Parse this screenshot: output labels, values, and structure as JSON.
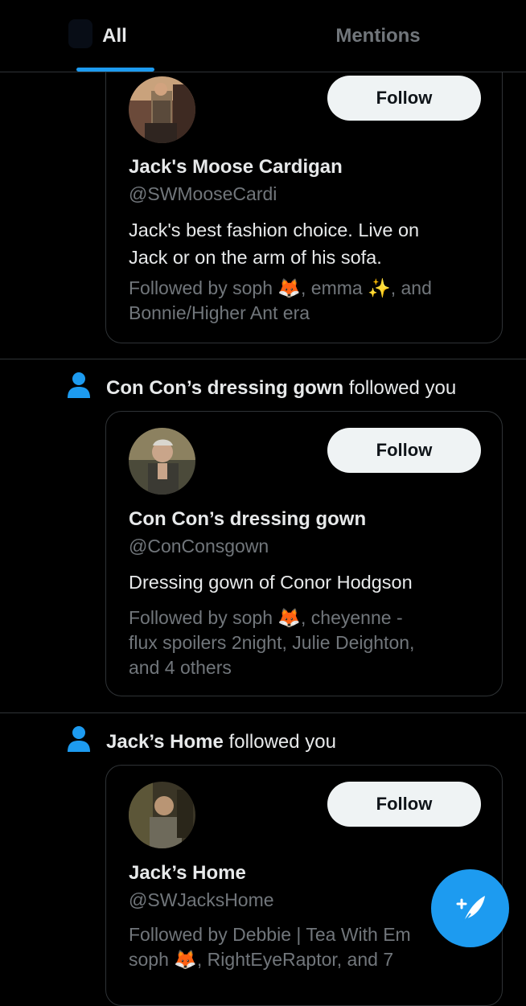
{
  "tabs": [
    {
      "label": "All",
      "active": true
    },
    {
      "label": "Mentions",
      "active": false
    }
  ],
  "notifications": [
    {
      "actor": "",
      "action": "",
      "card": {
        "name": "Jack's Moose Cardigan",
        "handle": "@SWMooseCardi",
        "follow_label": "Follow",
        "bio_lines": [
          "Jack's best fashion choice. Live on",
          "Jack or on the arm of his sofa."
        ],
        "followed_by_lines": [
          "Followed by soph 🦊, emma ✨, and",
          "Bonnie/Higher Ant era"
        ]
      }
    },
    {
      "actor": "Con Con’s dressing gown",
      "action": "followed you",
      "card": {
        "name": "Con Con’s dressing gown",
        "handle": "@ConConsgown",
        "follow_label": "Follow",
        "bio_lines": [
          "Dressing gown of Conor Hodgson"
        ],
        "followed_by_lines": [
          "Followed by soph 🦊, cheyenne -",
          "flux spoilers 2night, Julie Deighton,",
          "and 4 others"
        ]
      }
    },
    {
      "actor": "Jack’s Home",
      "action": "followed you",
      "card": {
        "name": "Jack’s Home",
        "handle": "@SWJacksHome",
        "follow_label": "Follow",
        "bio_lines": [],
        "followed_by_lines": [
          "Followed by Debbie | Tea With Em",
          "soph 🦊, RightEyeRaptor, and 7"
        ]
      }
    }
  ],
  "icons": {
    "person": "person-icon",
    "compose": "compose-tweet-icon"
  },
  "colors": {
    "accent": "#1d9bf0",
    "background": "#000000",
    "text": "#e7e9ea",
    "muted": "#71767b"
  }
}
